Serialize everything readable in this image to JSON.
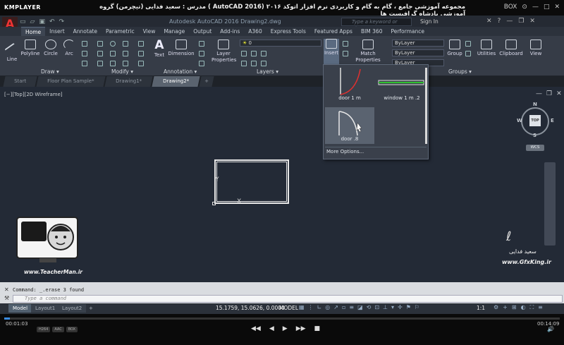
{
  "player": {
    "logo": "KMPLAYER",
    "title": "مجموعه آموزشی جامع ، گام به گام و کاربردی نرم افزار  اتوکد ۲۰۱۶ (AutoCAD 2016 )  مدرس : سعید فدایی (تیچرمن) گروه آموزشی پادشاه گرافیست ها",
    "controls": [
      "BOX",
      "⊙",
      "—",
      "□",
      "✕"
    ],
    "time_current": "00:01:03",
    "time_total": "00:14:09",
    "badges": [
      "H264",
      "AAC",
      "BOX"
    ],
    "transport": [
      "◀◀",
      "◀",
      "▶",
      "▶▶",
      "■"
    ],
    "volume_icon": "speaker-icon"
  },
  "cad": {
    "app_letter": "A",
    "doc_title": "Autodesk AutoCAD 2016    Drawing2.dwg",
    "search_placeholder": "Type a keyword or phrase",
    "sign_in": "Sign In",
    "ribbon_tabs": [
      "Home",
      "Insert",
      "Annotate",
      "Parametric",
      "View",
      "Manage",
      "Output",
      "Add-ins",
      "A360",
      "Express Tools",
      "Featured Apps",
      "BIM 360",
      "Performance"
    ],
    "panels": {
      "draw": {
        "label": "Draw ▾",
        "tools": [
          "Line",
          "Polyline",
          "Circle",
          "Arc"
        ]
      },
      "modify": {
        "label": "Modify ▾"
      },
      "annotation": {
        "label": "Annotation ▾",
        "tools": [
          "Text",
          "Dimension"
        ]
      },
      "layers": {
        "label": "Layers ▾",
        "tool": "Layer Properties",
        "layer_value": "0"
      },
      "block": {
        "tool": "Insert",
        "match": "Match Properties"
      },
      "properties": {
        "bylayer1": "ByLayer",
        "bylayer2": "ByLayer",
        "bylayer3": "ByLayer"
      },
      "groups": {
        "tool": "Group",
        "label": "Groups ▾"
      },
      "utilities": "Utilities",
      "clipboard": "Clipboard",
      "view": "View"
    },
    "doc_tabs": [
      "Start",
      "Floor Plan Sample*",
      "Drawing1*",
      "Drawing2*",
      "+"
    ],
    "viewport_label": "[−][Top][2D Wireframe]",
    "viewcube": {
      "face": "TOP",
      "n": "N",
      "s": "S",
      "e": "E",
      "w": "W",
      "wcs": "WCS"
    },
    "insert_dropdown": {
      "blocks": [
        "door 1 m",
        "window 1 m .2",
        "door .8"
      ],
      "more": "More Options..."
    },
    "ucs": {
      "y": "Y",
      "x": "X"
    },
    "watermark": {
      "teacherman_url": "www.TeacherMan.ir",
      "gfx_name": "سعید فدایی",
      "gfx_url": "www.GfxKing.ir"
    },
    "command": {
      "history": "Command: _.erase 3 found",
      "placeholder": "Type a command",
      "close": "✕",
      "wrench": "🔧"
    },
    "layout_tabs": [
      "Model",
      "Layout1",
      "Layout2",
      "+"
    ],
    "status": {
      "coords": "15.1759, 15.0626, 0.0000",
      "model": "MODEL",
      "scale": "1:1"
    }
  }
}
